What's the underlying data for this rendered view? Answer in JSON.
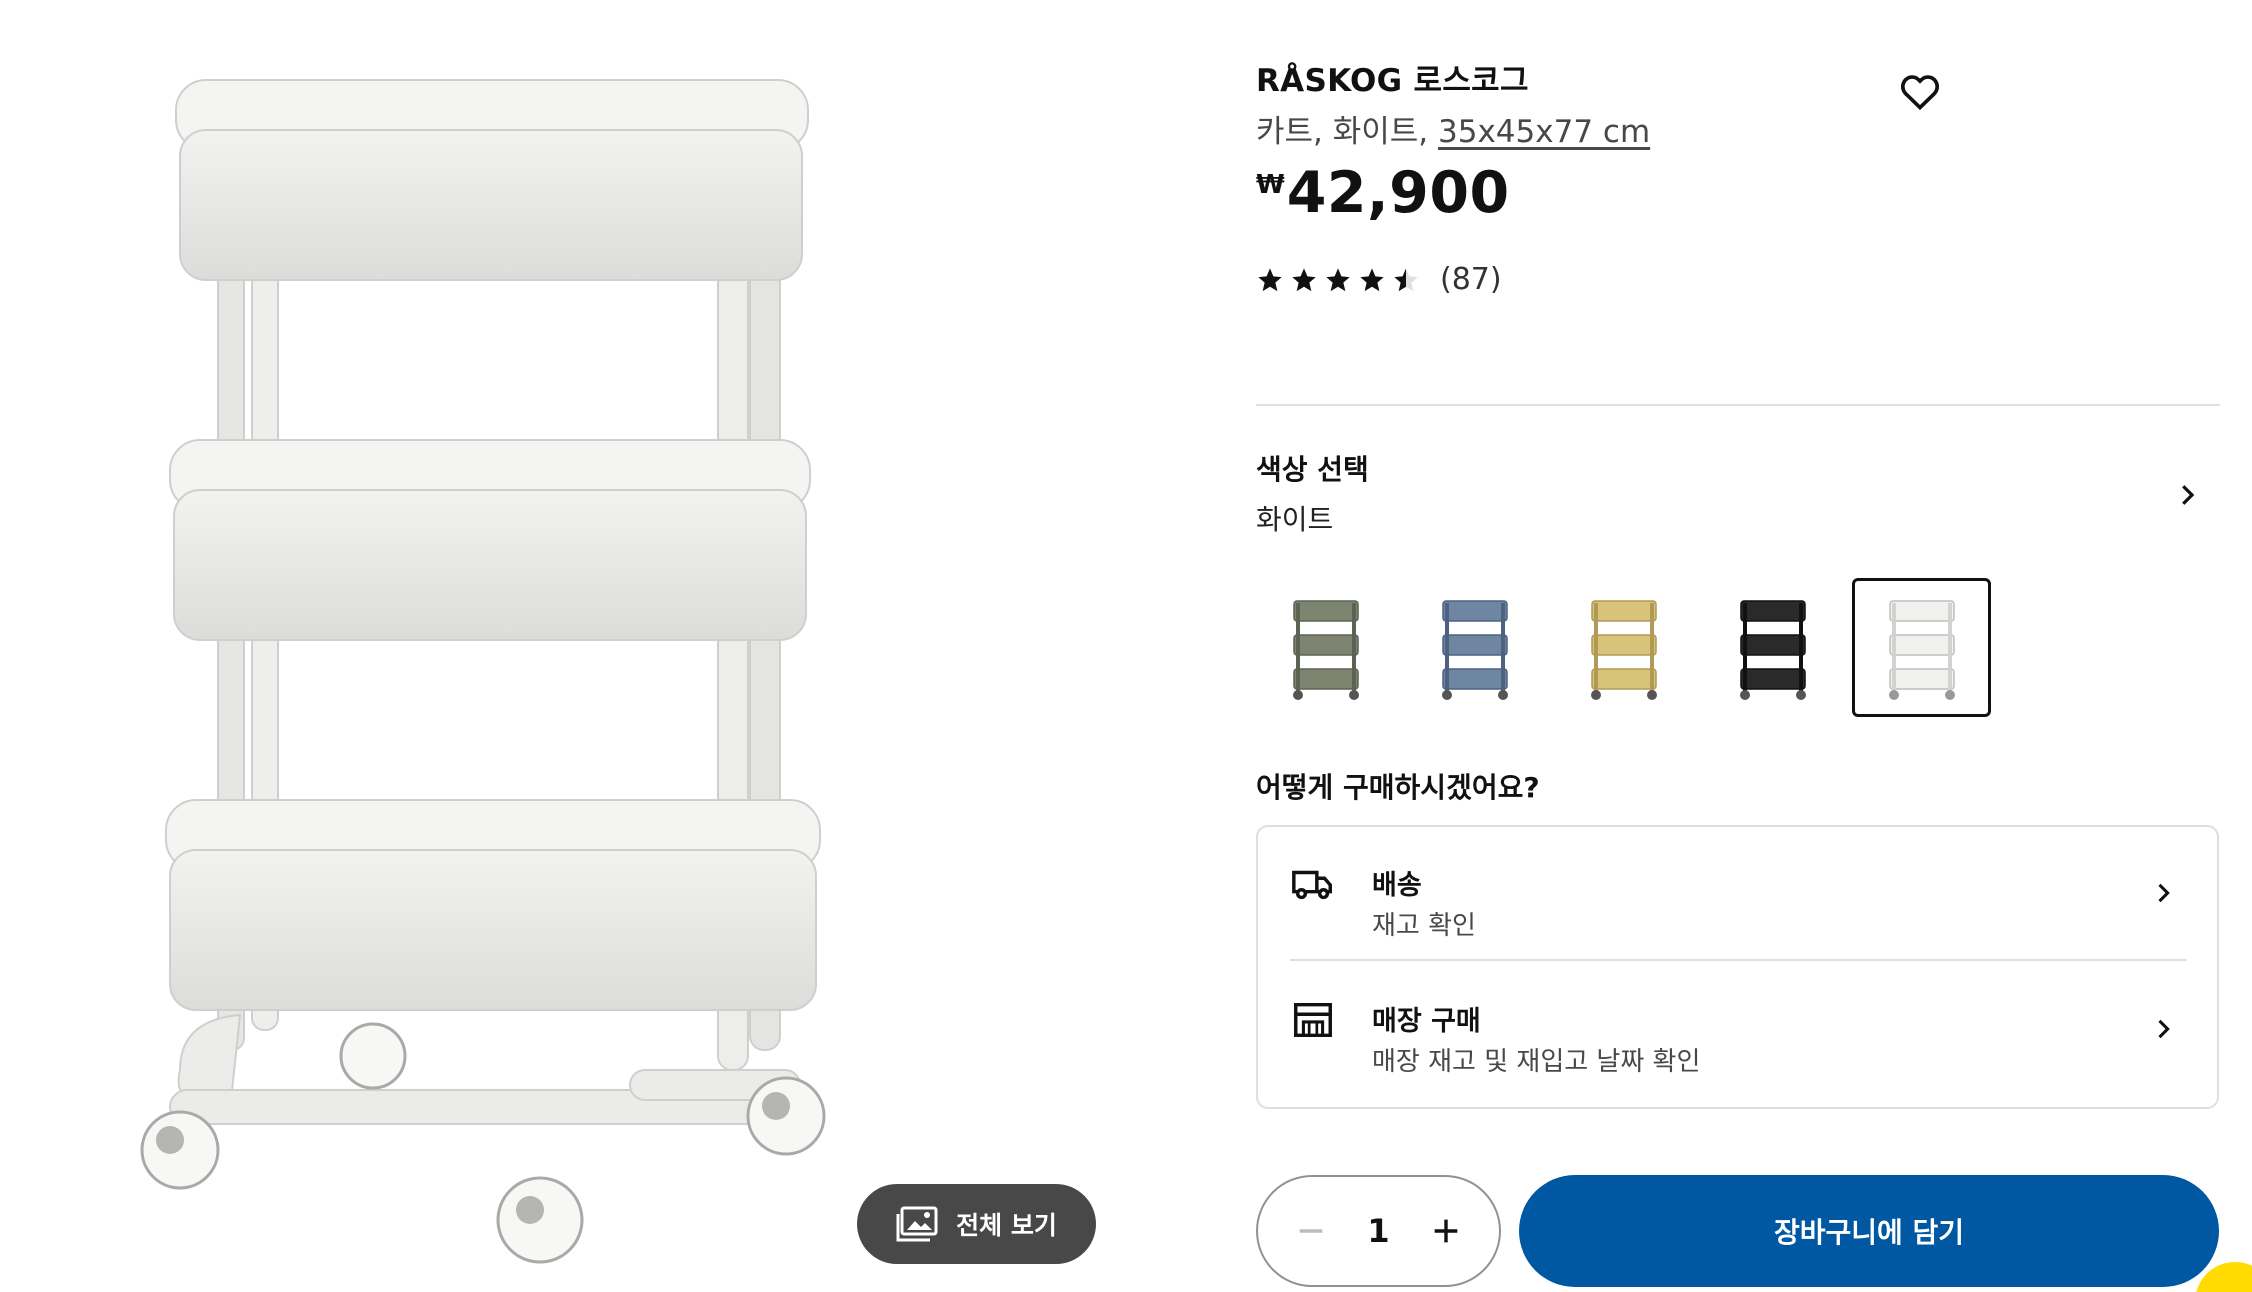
{
  "product": {
    "name": "RÅSKOG 로스코그",
    "description": "카트, 화이트, ",
    "dimensions": "35x45x77 cm",
    "currency_symbol": "₩",
    "price": "42,900",
    "rating": 4.5,
    "review_count": "(87)"
  },
  "gallery": {
    "view_all_label": "전체 보기"
  },
  "color": {
    "label": "색상 선택",
    "selected": "화이트",
    "swatches": [
      {
        "name": "green-gray",
        "color": "#7d8570"
      },
      {
        "name": "blue",
        "color": "#6f86a3"
      },
      {
        "name": "beige",
        "color": "#d9c27a"
      },
      {
        "name": "black",
        "color": "#2a2a2a"
      },
      {
        "name": "white",
        "color": "#e7e7e4"
      }
    ]
  },
  "purchase": {
    "heading": "어떻게 구매하시겠어요?",
    "delivery": {
      "title": "배송",
      "subtitle": "재고 확인"
    },
    "store": {
      "title": "매장 구매",
      "subtitle": "매장 재고 및 재입고 날짜 확인"
    }
  },
  "cart": {
    "quantity": "1",
    "add_label": "장바구니에 담기"
  },
  "colors": {
    "primary_blue": "#0058a3",
    "dark_button": "#484848"
  }
}
